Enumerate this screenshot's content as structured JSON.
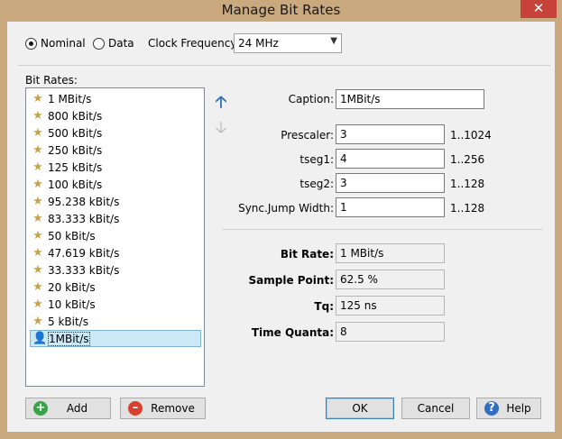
{
  "window": {
    "title": "Manage Bit Rates",
    "close_glyph": "✕"
  },
  "mode": {
    "nominal_label": "Nominal",
    "data_label": "Data",
    "selected": "Nominal"
  },
  "clock": {
    "label": "Clock Frequency:",
    "value": "24 MHz"
  },
  "bitrates": {
    "label": "Bit Rates:",
    "items": [
      {
        "label": "1 MBit/s",
        "icon": "star-icon"
      },
      {
        "label": "800 kBit/s",
        "icon": "star-icon"
      },
      {
        "label": "500 kBit/s",
        "icon": "star-icon"
      },
      {
        "label": "250 kBit/s",
        "icon": "star-icon"
      },
      {
        "label": "125 kBit/s",
        "icon": "star-icon"
      },
      {
        "label": "100 kBit/s",
        "icon": "star-icon"
      },
      {
        "label": "95.238 kBit/s",
        "icon": "star-icon"
      },
      {
        "label": "83.333 kBit/s",
        "icon": "star-icon"
      },
      {
        "label": "50 kBit/s",
        "icon": "star-icon"
      },
      {
        "label": "47.619 kBit/s",
        "icon": "star-icon"
      },
      {
        "label": "33.333 kBit/s",
        "icon": "star-icon"
      },
      {
        "label": "20 kBit/s",
        "icon": "star-icon"
      },
      {
        "label": "10 kBit/s",
        "icon": "star-icon"
      },
      {
        "label": "5 kBit/s",
        "icon": "star-icon"
      },
      {
        "label": "1MBit/s",
        "icon": "user-icon",
        "selected": true
      }
    ]
  },
  "form": {
    "caption_label": "Caption:",
    "caption_value": "1MBit/s",
    "prescaler_label": "Prescaler:",
    "prescaler_value": "3",
    "prescaler_range": "1..1024",
    "tseg1_label": "tseg1:",
    "tseg1_value": "4",
    "tseg1_range": "1..256",
    "tseg2_label": "tseg2:",
    "tseg2_value": "3",
    "tseg2_range": "1..128",
    "sjw_label": "Sync.Jump Width:",
    "sjw_value": "1",
    "sjw_range": "1..128"
  },
  "results": {
    "bitrate_label": "Bit Rate:",
    "bitrate_value": "1 MBit/s",
    "sample_label": "Sample Point:",
    "sample_value": "62.5 %",
    "tq_label": "Tq:",
    "tq_value": "125 ns",
    "quanta_label": "Time Quanta:",
    "quanta_value": "8"
  },
  "buttons": {
    "add": "Add",
    "remove": "Remove",
    "ok": "OK",
    "cancel": "Cancel",
    "help": "Help"
  },
  "colors": {
    "title_bar": "#c9a97d",
    "close": "#c7433a",
    "selection": "#cce8f4",
    "star": "#c8a24a"
  }
}
